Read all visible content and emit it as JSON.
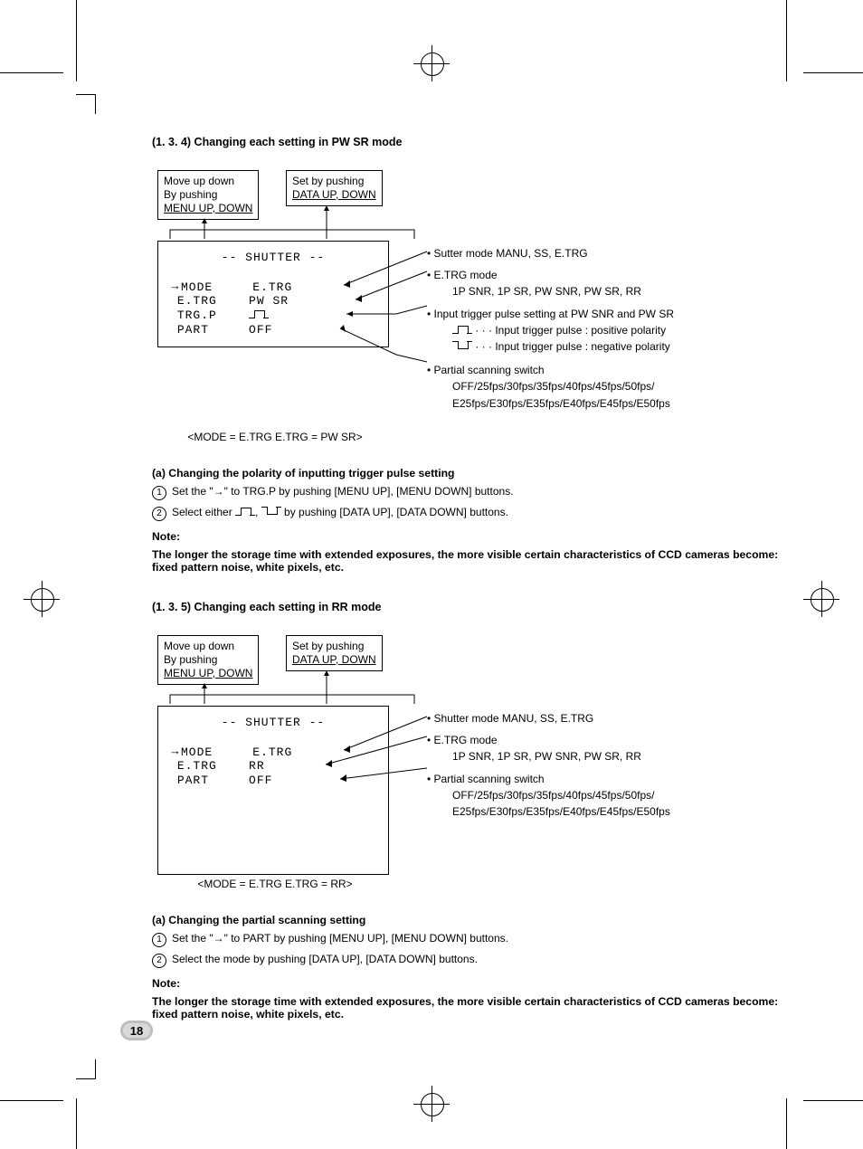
{
  "page_number": "18",
  "section1": {
    "heading": "(1. 3. 4)   Changing each setting in PW SR mode",
    "instr_box1_l1": "Move up down",
    "instr_box1_l2": "By pushing",
    "instr_box1_l3": "MENU UP, DOWN",
    "instr_box2_l1": "Set by pushing",
    "instr_box2_l2": "DATA UP, DOWN",
    "osd_title": "-- SHUTTER --",
    "osd_left_1": "MODE",
    "osd_left_2": "E.TRG",
    "osd_left_3": "TRG.P",
    "osd_left_4": "PART",
    "osd_right_1": "E.TRG",
    "osd_right_2": "PW SR",
    "osd_right_4": "OFF",
    "b1": "• Sutter mode   MANU, SS, E.TRG",
    "b2": "• E.TRG mode",
    "b2s": "1P SNR, 1P SR, PW SNR, PW SR, RR",
    "b3": "• Input trigger pulse setting at PW SNR and PW SR",
    "b3s1_tail": " · · · Input trigger pulse : positive polarity",
    "b3s2_tail": " · · · Input trigger pulse : negative polarity",
    "b4": "• Partial scanning switch",
    "b4s1": "OFF/25fps/30fps/35fps/40fps/45fps/50fps/",
    "b4s2": "E25fps/E30fps/E35fps/E40fps/E45fps/E50fps",
    "caption": "<MODE = E.TRG   E.TRG = PW SR>",
    "sub_a": "(a)   Changing the polarity of inputting trigger pulse setting",
    "step1": "Set the \"→\" to TRG.P by pushing [MENU UP], [MENU DOWN] buttons.",
    "step2_pre": "Select either ",
    "step2_mid": ", ",
    "step2_post": " by pushing [DATA UP], [DATA DOWN] buttons.",
    "note_title": "Note:",
    "note_body": "The longer the storage time with extended exposures, the more visible certain characteristics of CCD cameras become: fixed pattern noise, white pixels, etc."
  },
  "section2": {
    "heading": "(1. 3. 5)   Changing each setting in RR mode",
    "instr_box1_l1": "Move up down",
    "instr_box1_l2": "By pushing",
    "instr_box1_l3": "MENU UP, DOWN",
    "instr_box2_l1": "Set by pushing",
    "instr_box2_l2": "DATA UP, DOWN",
    "osd_title": "-- SHUTTER --",
    "osd_left_1": "MODE",
    "osd_left_2": "E.TRG",
    "osd_left_3": "PART",
    "osd_right_1": "E.TRG",
    "osd_right_2": "RR",
    "osd_right_3": "OFF",
    "b1": "• Shutter mode   MANU, SS, E.TRG",
    "b2": "• E.TRG mode",
    "b2s": "1P SNR, 1P SR, PW SNR, PW SR, RR",
    "b3": "• Partial scanning switch",
    "b3s1": "OFF/25fps/30fps/35fps/40fps/45fps/50fps/",
    "b3s2": "E25fps/E30fps/E35fps/E40fps/E45fps/E50fps",
    "caption": "<MODE = E.TRG   E.TRG = RR>",
    "sub_a": "(a)   Changing the partial scanning setting",
    "step1": "Set the \"→\" to PART by pushing [MENU UP], [MENU DOWN] buttons.",
    "step2": "Select the mode by pushing [DATA UP], [DATA DOWN] buttons.",
    "note_title": "Note:",
    "note_body": "The longer the storage time with extended exposures, the more visible certain characteristics of CCD cameras become: fixed pattern noise, white pixels, etc."
  }
}
